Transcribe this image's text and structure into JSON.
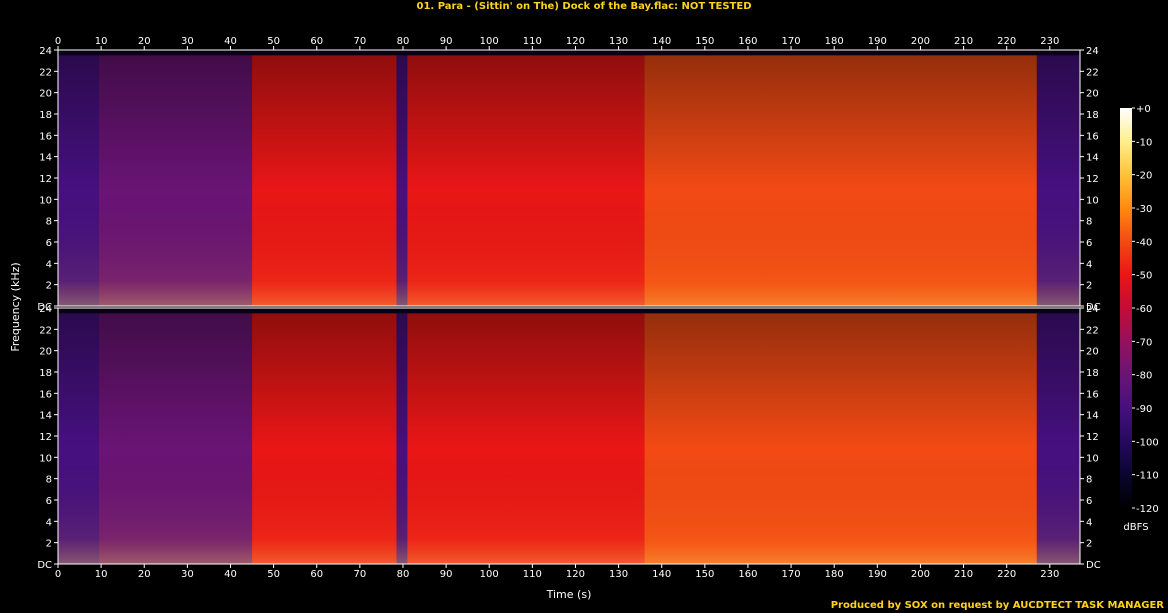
{
  "header": {
    "title": "01. Para - (Sittin' on The) Dock of the Bay.flac: NOT TESTED"
  },
  "footer": {
    "credit": "Produced by SOX on request by AUCDTECT TASK MANAGER"
  },
  "colorbar": {
    "unit": "dBFS",
    "labels": [
      "+0",
      "-10",
      "-20",
      "-30",
      "-40",
      "-50",
      "-60",
      "-70",
      "-80",
      "-90",
      "-100",
      "-110",
      "-120"
    ],
    "values": [
      0,
      -10,
      -20,
      -30,
      -40,
      -50,
      -60,
      -70,
      -80,
      -90,
      -100,
      -110,
      -120
    ]
  },
  "colors": {
    "bg": "#000000",
    "text": "#ffffff",
    "title": "#ffd21e",
    "gradient": [
      "#000000",
      "#0a0530",
      "#250a5e",
      "#46107f",
      "#6a1475",
      "#95115c",
      "#c40c36",
      "#ea1616",
      "#f34a14",
      "#ff8a10",
      "#ffc23a",
      "#ffef8c",
      "#ffffff"
    ]
  },
  "chart_data": {
    "type": "heatmap",
    "title": "01. Para - (Sittin' on The) Dock of the Bay.flac: NOT TESTED",
    "xlabel": "Time (s)",
    "ylabel": "Frequency (kHz)",
    "xlim": [
      0,
      237
    ],
    "ylim": [
      0,
      24
    ],
    "x_ticks": [
      0,
      10,
      20,
      30,
      40,
      50,
      60,
      70,
      80,
      90,
      100,
      110,
      120,
      130,
      140,
      150,
      160,
      170,
      180,
      190,
      200,
      210,
      220,
      230
    ],
    "x_tick_labels": [
      "0",
      "10",
      "20",
      "30",
      "40",
      "50",
      "60",
      "70",
      "80",
      "90",
      "100",
      "110",
      "120",
      "130",
      "140",
      "150",
      "160",
      "170",
      "180",
      "190",
      "200",
      "210",
      "220",
      "230"
    ],
    "y_ticks": [
      0,
      2,
      4,
      6,
      8,
      10,
      12,
      14,
      16,
      18,
      20,
      22,
      24
    ],
    "y_tick_labels": [
      "DC",
      "2",
      "4",
      "6",
      "8",
      "10",
      "12",
      "14",
      "16",
      "18",
      "20",
      "22",
      "24"
    ],
    "channels": 2,
    "segments": [
      {
        "start": 0,
        "end": 9.5,
        "level_dbfs": -95
      },
      {
        "start": 9.5,
        "end": 45,
        "level_dbfs": -80
      },
      {
        "start": 45,
        "end": 78.5,
        "level_dbfs": -50
      },
      {
        "start": 78.5,
        "end": 81,
        "level_dbfs": -90
      },
      {
        "start": 81,
        "end": 136,
        "level_dbfs": -50
      },
      {
        "start": 136,
        "end": 227,
        "level_dbfs": -45
      },
      {
        "start": 227,
        "end": 237,
        "level_dbfs": -95
      }
    ],
    "cutoff_khz": 23.5,
    "colorbar_range": [
      -120,
      0
    ],
    "colorbar_unit": "dBFS"
  }
}
